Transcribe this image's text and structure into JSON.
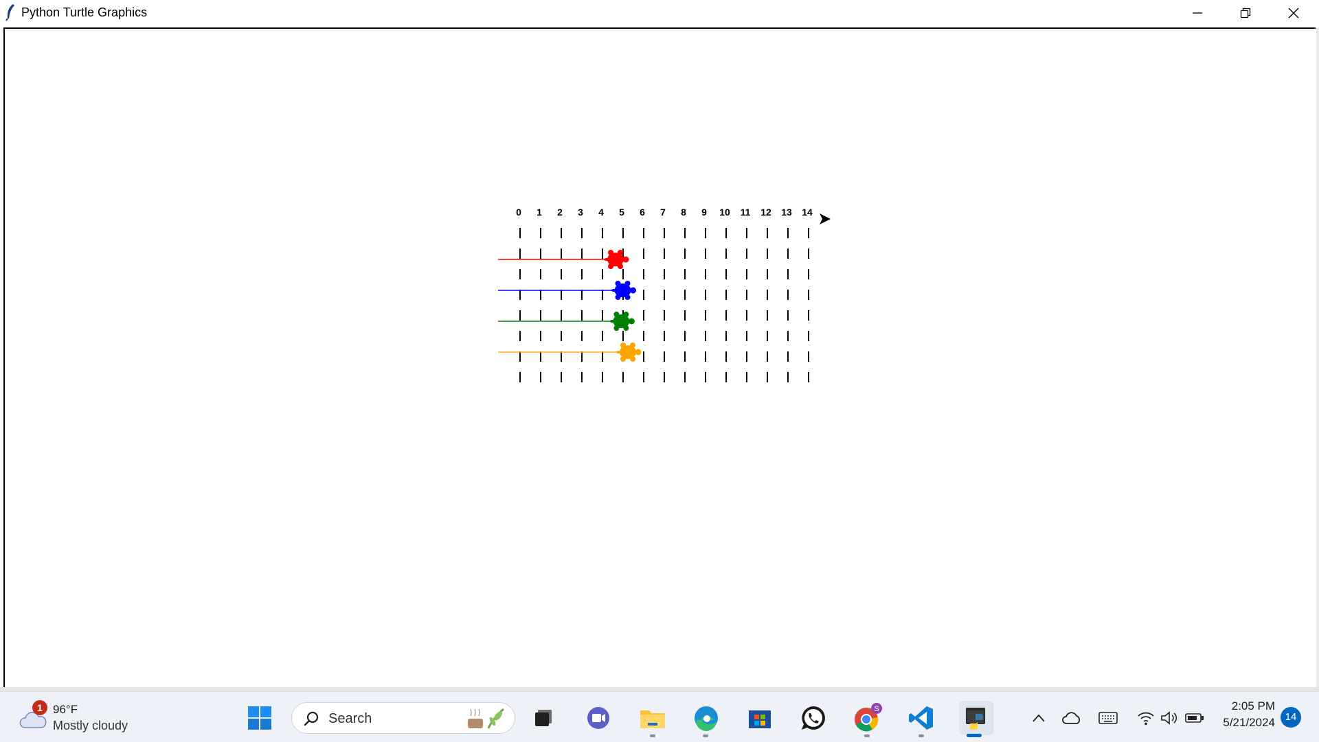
{
  "window": {
    "title": "Python Turtle Graphics"
  },
  "canvas": {
    "finish_arrow": "black-arrow-turtle",
    "track_marks": {
      "labels": [
        "0",
        "1",
        "2",
        "3",
        "4",
        "5",
        "6",
        "7",
        "8",
        "9",
        "10",
        "11",
        "12",
        "13",
        "14"
      ],
      "rows": 8
    },
    "turtles": [
      {
        "color": "#ff0000",
        "position": 4.7
      },
      {
        "color": "#0000ff",
        "position": 5.05
      },
      {
        "color": "#008000",
        "position": 4.98
      },
      {
        "color": "#ffa500",
        "position": 5.3
      }
    ]
  },
  "taskbar": {
    "weather": {
      "badge": "1",
      "temp": "96°F",
      "desc": "Mostly cloudy",
      "icon": "cloud-icon"
    },
    "search": {
      "placeholder": "Search"
    },
    "apps": [
      {
        "name": "start-button",
        "icon": "windows-logo-icon"
      },
      {
        "name": "task-view-button",
        "icon": "task-view-icon"
      },
      {
        "name": "teams-button",
        "icon": "teams-video-icon"
      },
      {
        "name": "file-explorer-button",
        "icon": "folder-icon"
      },
      {
        "name": "edge-button",
        "icon": "edge-icon"
      },
      {
        "name": "store-button",
        "icon": "store-icon"
      },
      {
        "name": "whatsapp-button",
        "icon": "whatsapp-icon"
      },
      {
        "name": "chrome-button",
        "icon": "chrome-icon",
        "badge": "S"
      },
      {
        "name": "vscode-button",
        "icon": "vscode-icon"
      },
      {
        "name": "python-turtle-button",
        "icon": "python-icon"
      }
    ],
    "clock": {
      "time": "2:05 PM",
      "date": "5/21/2024"
    },
    "notifications": "14"
  }
}
